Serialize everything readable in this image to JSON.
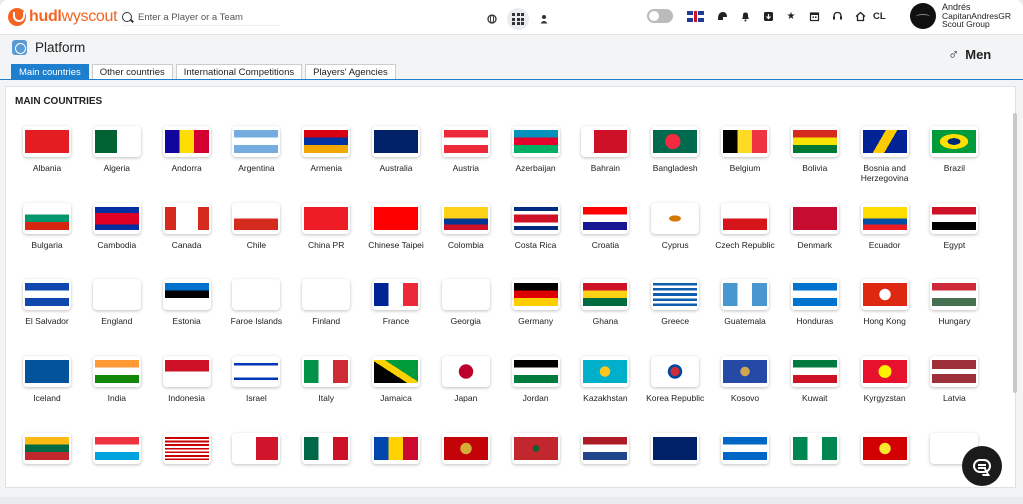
{
  "app": {
    "logo_bold": "hudl",
    "logo_rest": "wyscout",
    "accent": "#f26522"
  },
  "search": {
    "placeholder": "Enter a Player or a Team"
  },
  "header_right": {
    "lang_code": "CL"
  },
  "user": {
    "name": "Andrés",
    "handle": "CapitanAndresGR",
    "group": "Scout Group"
  },
  "page": {
    "title": "Platform",
    "gender": "Men"
  },
  "tabs": [
    {
      "label": "Main countries",
      "active": true
    },
    {
      "label": "Other countries",
      "active": false
    },
    {
      "label": "International Competitions",
      "active": false
    },
    {
      "label": "Players' Agencies",
      "active": false
    }
  ],
  "section": {
    "title": "MAIN COUNTRIES"
  },
  "countries": [
    {
      "name": "Albania",
      "flag": "linear-gradient(#e41e20,#e41e20)"
    },
    {
      "name": "Algeria",
      "flag": "linear-gradient(90deg,#006233 50%,#fff 50%)"
    },
    {
      "name": "Andorra",
      "flag": "linear-gradient(90deg,#10069f 33%,#fedd00 33%,#fedd00 66%,#d50032 66%)"
    },
    {
      "name": "Argentina",
      "flag": "linear-gradient(#74acdf 33%,#fff 33%,#fff 66%,#74acdf 66%)"
    },
    {
      "name": "Armenia",
      "flag": "linear-gradient(#d90012 33%,#0033a0 33%,#0033a0 66%,#f2a800 66%)"
    },
    {
      "name": "Australia",
      "flag": "linear-gradient(#012169,#012169)"
    },
    {
      "name": "Austria",
      "flag": "linear-gradient(#ed2939 33%,#fff 33%,#fff 66%,#ed2939 66%)"
    },
    {
      "name": "Azerbaijan",
      "flag": "linear-gradient(#0092bc 33%,#e4002b 33%,#e4002b 66%,#00af66 66%)"
    },
    {
      "name": "Bahrain",
      "flag": "linear-gradient(90deg,#fff 25%,#ce1126 25%)"
    },
    {
      "name": "Bangladesh",
      "flag": "radial-gradient(circle at 45% 50%,#f42a41 28%,#006a4e 29%)"
    },
    {
      "name": "Belgium",
      "flag": "linear-gradient(90deg,#000 33%,#fdda24 33%,#fdda24 66%,#ef3340 66%)"
    },
    {
      "name": "Bolivia",
      "flag": "linear-gradient(#d52b1e 33%,#f9e300 33%,#f9e300 66%,#007934 66%)"
    },
    {
      "name": "Bosnia and Herzegovina",
      "flag": "linear-gradient(120deg,#002395 40%,#fecb00 40%,#fecb00 60%,#002395 60%)"
    },
    {
      "name": "Brazil",
      "flag": "radial-gradient(ellipse at center,#002776 20%,#ffdf00 21%,#ffdf00 45%,#009c3b 46%)"
    },
    {
      "name": "Bulgaria",
      "flag": "linear-gradient(#fff 33%,#00966e 33%,#00966e 66%,#d62612 66%)"
    },
    {
      "name": "Cambodia",
      "flag": "linear-gradient(#032ea1 25%,#e00025 25%,#e00025 75%,#032ea1 75%)"
    },
    {
      "name": "Canada",
      "flag": "linear-gradient(90deg,#d52b1e 25%,#fff 25%,#fff 75%,#d52b1e 75%)"
    },
    {
      "name": "Chile",
      "flag": "linear-gradient(#fff 50%,#d52b1e 50%)"
    },
    {
      "name": "China PR",
      "flag": "linear-gradient(#ee1c25,#ee1c25)"
    },
    {
      "name": "Chinese Taipei",
      "flag": "linear-gradient(#fe0000,#fe0000)"
    },
    {
      "name": "Colombia",
      "flag": "linear-gradient(#fcd116 50%,#003893 50%,#003893 75%,#ce1126 75%)"
    },
    {
      "name": "Costa Rica",
      "flag": "linear-gradient(#002b7f 17%,#fff 17%,#fff 33%,#ce1126 33%,#ce1126 67%,#fff 67%,#fff 83%,#002b7f 83%)"
    },
    {
      "name": "Croatia",
      "flag": "linear-gradient(#ff0000 33%,#fff 33%,#fff 66%,#171796 66%)"
    },
    {
      "name": "Cyprus",
      "flag": "radial-gradient(ellipse at center,#d57800 18%,#fff 20%)"
    },
    {
      "name": "Czech Republic",
      "flag": "linear-gradient(#fff 50%,#d7141a 50%)"
    },
    {
      "name": "Denmark",
      "flag": "linear-gradient(#c60c30,#c60c30)"
    },
    {
      "name": "Ecuador",
      "flag": "linear-gradient(#ffdd00 50%,#034ea2 50%,#034ea2 75%,#ed1c24 75%)"
    },
    {
      "name": "Egypt",
      "flag": "linear-gradient(#ce1126 33%,#fff 33%,#fff 66%,#000 66%)"
    },
    {
      "name": "El Salvador",
      "flag": "linear-gradient(#0f47af 33%,#fff 33%,#fff 66%,#0f47af 66%)"
    },
    {
      "name": "England",
      "flag": "linear-gradient(#fff,#fff)"
    },
    {
      "name": "Estonia",
      "flag": "linear-gradient(#0072ce 33%,#000 33%,#000 66%,#fff 66%)"
    },
    {
      "name": "Faroe Islands",
      "flag": "linear-gradient(#fff,#fff)"
    },
    {
      "name": "Finland",
      "flag": "linear-gradient(#fff,#fff)"
    },
    {
      "name": "France",
      "flag": "linear-gradient(90deg,#002395 33%,#fff 33%,#fff 66%,#ed2939 66%)"
    },
    {
      "name": "Georgia",
      "flag": "linear-gradient(#fff,#fff)"
    },
    {
      "name": "Germany",
      "flag": "linear-gradient(#000 33%,#dd0000 33%,#dd0000 66%,#ffce00 66%)"
    },
    {
      "name": "Ghana",
      "flag": "linear-gradient(#ce1126 33%,#fcd116 33%,#fcd116 66%,#006b3f 66%)"
    },
    {
      "name": "Greece",
      "flag": "repeating-linear-gradient(#0d5eaf 0 2.6px,#fff 2.6px 5.1px)"
    },
    {
      "name": "Guatemala",
      "flag": "linear-gradient(90deg,#4997d0 33%,#fff 33%,#fff 66%,#4997d0 66%)"
    },
    {
      "name": "Honduras",
      "flag": "linear-gradient(#0073cf 33%,#fff 33%,#fff 66%,#0073cf 66%)"
    },
    {
      "name": "Hong Kong",
      "flag": "radial-gradient(circle,#fff 22%,#de2910 24%)"
    },
    {
      "name": "Hungary",
      "flag": "linear-gradient(#ce2939 33%,#fff 33%,#fff 66%,#477050 66%)"
    },
    {
      "name": "Iceland",
      "flag": "linear-gradient(#02529c,#02529c)"
    },
    {
      "name": "India",
      "flag": "linear-gradient(#ff9933 33%,#fff 33%,#fff 66%,#138808 66%)"
    },
    {
      "name": "Indonesia",
      "flag": "linear-gradient(#ce1126 50%,#fff 50%)"
    },
    {
      "name": "Israel",
      "flag": "linear-gradient(#fff 12%,#0038b8 12%,#0038b8 24%,#fff 24%,#fff 76%,#0038b8 76%,#0038b8 88%,#fff 88%)"
    },
    {
      "name": "Italy",
      "flag": "linear-gradient(90deg,#009246 33%,#fff 33%,#fff 66%,#ce2b37 66%)"
    },
    {
      "name": "Jamaica",
      "flag": "linear-gradient(33deg,#000 42%,#fed100 42%,#fed100 58%,#009b3a 58%)"
    },
    {
      "name": "Japan",
      "flag": "radial-gradient(circle,#bc002d 28%,#fff 30%)"
    },
    {
      "name": "Jordan",
      "flag": "linear-gradient(#000 33%,#fff 33%,#fff 66%,#007a3d 66%)"
    },
    {
      "name": "Kazakhstan",
      "flag": "radial-gradient(circle,#ffc61e 20%,#00afca 22%)"
    },
    {
      "name": "Korea Republic",
      "flag": "radial-gradient(circle,#cd2e3a 18%,#0047a0 19%,#0047a0 28%,#fff 30%)"
    },
    {
      "name": "Kosovo",
      "flag": "radial-gradient(circle,#d0a650 18%,#244aa5 20%)"
    },
    {
      "name": "Kuwait",
      "flag": "linear-gradient(#007a3d 33%,#fff 33%,#fff 66%,#ce1126 66%)"
    },
    {
      "name": "Kyrgyzstan",
      "flag": "radial-gradient(circle,#ffef00 25%,#e8112d 27%)"
    },
    {
      "name": "Latvia",
      "flag": "linear-gradient(#9e3039 40%,#fff 40%,#fff 60%,#9e3039 60%)"
    },
    {
      "name": "",
      "flag": "linear-gradient(#fdb913 33%,#006a44 33%,#006a44 66%,#c1272d 66%)"
    },
    {
      "name": "",
      "flag": "linear-gradient(#ef3340 33%,#fff 33%,#fff 66%,#00a3e0 66%)"
    },
    {
      "name": "",
      "flag": "repeating-linear-gradient(#cc0001 0 1.8px,#fff 1.8px 3.6px)"
    },
    {
      "name": "",
      "flag": "linear-gradient(90deg,#fff 50%,#cf142b 50%)"
    },
    {
      "name": "",
      "flag": "linear-gradient(90deg,#006847 33%,#fff 33%,#fff 66%,#ce1126 66%)"
    },
    {
      "name": "",
      "flag": "linear-gradient(90deg,#0046ae 33%,#ffd200 33%,#ffd200 66%,#cc092f 66%)"
    },
    {
      "name": "",
      "flag": "radial-gradient(circle,#d4af37 22%,#c40308 24%)"
    },
    {
      "name": "",
      "flag": "radial-gradient(circle,#006233 12%,#c1272d 14%)"
    },
    {
      "name": "",
      "flag": "linear-gradient(#ae1c28 33%,#fff 33%,#fff 66%,#21468b 66%)"
    },
    {
      "name": "",
      "flag": "linear-gradient(#012169,#012169)"
    },
    {
      "name": "",
      "flag": "linear-gradient(#0067c6 33%,#fff 33%,#fff 66%,#0067c6 66%)"
    },
    {
      "name": "",
      "flag": "linear-gradient(90deg,#008751 33%,#fff 33%,#fff 66%,#008751 66%)"
    },
    {
      "name": "",
      "flag": "radial-gradient(circle,#f8e92e 22%,#d20000 24%)"
    },
    {
      "name": "",
      "flag": "linear-gradient(#fff,#fff)"
    }
  ]
}
